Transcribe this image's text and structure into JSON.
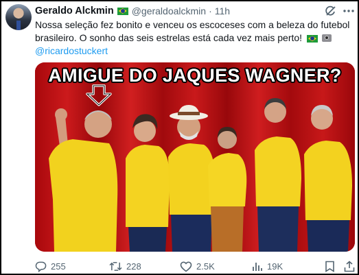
{
  "tweet": {
    "author_name": "Geraldo Alckmin",
    "author_flag": "brazil-flag",
    "handle": "@geraldoalckmin",
    "separator": "·",
    "time": "11h",
    "text_main": "Nossa seleção fez bonito e venceu os escoceses com a beleza do futebol brasileiro. O sonho das seis estrelas está cada vez mais perto!",
    "text_icons": [
      "brazil-flag",
      "camera-icon"
    ],
    "mention": "@ricardostuckert",
    "image_caption": "AMIGUE DO JAQUES WAGNER?",
    "link_color": "#1d9bf0"
  },
  "actions": {
    "replies": "255",
    "retweets": "228",
    "likes": "2.5K",
    "views": "19K"
  }
}
